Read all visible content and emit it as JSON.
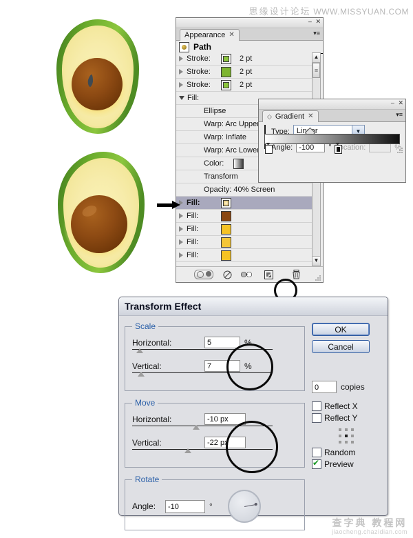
{
  "watermarks": {
    "top_cn": "思缘设计论坛",
    "top_en": "WWW.MISSYUAN.COM",
    "bottom_cn": "查字典 教程网",
    "bottom_en": "jiaocheng.chazidian.com"
  },
  "illustration": {
    "name": "avocado-half-illustration",
    "count_label": "2"
  },
  "appearance_panel": {
    "tab_label": "Appearance",
    "tab_close": "✕",
    "minimize": "–",
    "close": "✕",
    "menu_glyph": "▾≡",
    "target_label": "Path",
    "rows": [
      {
        "type": "disclosure",
        "label": "Stroke:",
        "swatch": "#8cc63e",
        "swatch_style": "inner",
        "value": "2 pt"
      },
      {
        "type": "disclosure",
        "label": "Stroke:",
        "swatch": "#7db52f",
        "swatch_style": "plain",
        "value": "2 pt"
      },
      {
        "type": "disclosure",
        "label": "Stroke:",
        "swatch": "#8cc63e",
        "swatch_style": "inner",
        "value": "2 pt"
      },
      {
        "type": "open",
        "label": "Fill:",
        "value": ""
      },
      {
        "type": "sub",
        "label": "Ellipse"
      },
      {
        "type": "sub",
        "label": "Warp: Arc Upper"
      },
      {
        "type": "sub",
        "label": "Warp: Inflate"
      },
      {
        "type": "sub",
        "label": "Warp: Arc Lower"
      },
      {
        "type": "sub-swatch",
        "label": "Color:",
        "swatch": "#3b3b3b"
      },
      {
        "type": "sub",
        "label": "Transform"
      },
      {
        "type": "sub",
        "label": "Opacity: 40% Screen"
      },
      {
        "type": "disclosure",
        "label": "Fill:",
        "swatch": "#d9b24a",
        "swatch_style": "inner",
        "value": "",
        "selected": true
      },
      {
        "type": "disclosure",
        "label": "Fill:",
        "swatch": "#8a4712",
        "swatch_style": "plain",
        "value": ""
      },
      {
        "type": "disclosure",
        "label": "Fill:",
        "swatch": "#f5c326",
        "swatch_style": "plain",
        "value": ""
      },
      {
        "type": "disclosure",
        "label": "Fill:",
        "swatch": "#f4c638",
        "swatch_style": "plain",
        "value": ""
      },
      {
        "type": "disclosure",
        "label": "Fill:",
        "swatch": "#f5c322",
        "swatch_style": "plain",
        "value": ""
      }
    ],
    "scrollbar": {
      "up": "▲",
      "down": "▼",
      "thumb": "≡"
    },
    "footer_buttons": [
      {
        "name": "toggle-visibility-button",
        "glyph": ""
      },
      {
        "name": "clear-appearance-button",
        "glyph": "⊘"
      },
      {
        "name": "reduce-to-basic-appearance-button",
        "glyph": "◐▸○"
      },
      {
        "name": "duplicate-item-button",
        "glyph": "❐",
        "highlighted": true
      },
      {
        "name": "delete-item-button",
        "glyph": "🗑"
      }
    ]
  },
  "gradient_panel": {
    "tab_label": "Gradient",
    "tab_close": "✕",
    "tab_icon": "◇",
    "minimize": "–",
    "close": "✕",
    "menu_glyph": "▾≡",
    "type_label": "Type:",
    "type_value": "Linear",
    "type_arrow": "▼",
    "angle_label": "Angle:",
    "angle_value": "-100",
    "angle_unit": "°",
    "location_label": "Location:",
    "location_value": "",
    "location_unit": "%"
  },
  "transform_dialog": {
    "title": "Transform Effect",
    "scale": {
      "legend": "Scale",
      "horizontal_label": "Horizontal:",
      "horizontal_value": "5",
      "horizontal_unit": "%",
      "vertical_label": "Vertical:",
      "vertical_value": "7",
      "vertical_unit": "%"
    },
    "move": {
      "legend": "Move",
      "horizontal_label": "Horizontal:",
      "horizontal_value": "-10 px",
      "vertical_label": "Vertical:",
      "vertical_value": "-22 px"
    },
    "rotate": {
      "legend": "Rotate",
      "angle_label": "Angle:",
      "angle_value": "-10",
      "angle_unit": "°"
    },
    "buttons": {
      "ok": "OK",
      "cancel": "Cancel"
    },
    "copies_value": "0",
    "copies_label": "copies",
    "checkboxes": [
      {
        "label": "Reflect X",
        "checked": false
      },
      {
        "label": "Reflect Y",
        "checked": false
      },
      {
        "label": "Random",
        "checked": false
      },
      {
        "label": "Preview",
        "checked": true
      }
    ]
  },
  "colors": {
    "accent_blue": "#2a5fa8",
    "dialog_bg": "#dfe0e4",
    "panel_bg": "#ececec",
    "selection": "#a9a9bd",
    "avocado_skin_dark": "#4e8c23",
    "avocado_skin_light": "#8cc63e",
    "avocado_flesh": "#f6eea8",
    "avocado_ring": "#f5c322",
    "avocado_pit": "#8a4712"
  }
}
